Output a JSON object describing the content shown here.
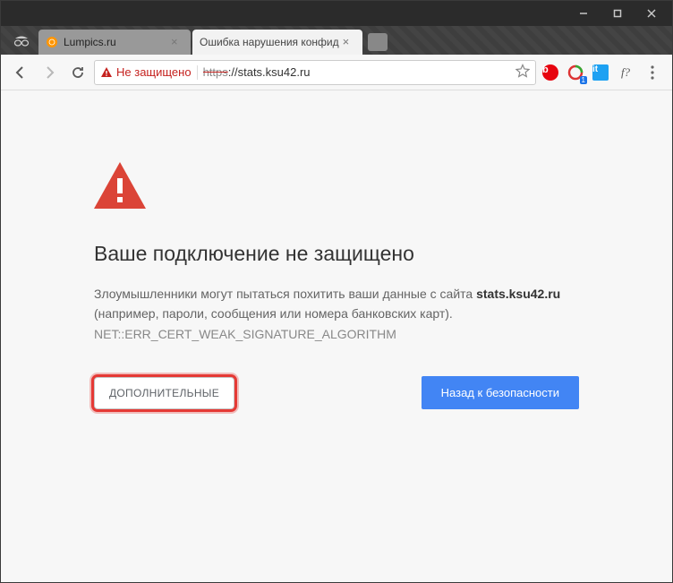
{
  "window": {
    "tabs": [
      {
        "title": "Lumpics.ru",
        "active": false
      },
      {
        "title": "Ошибка нарушения конфид",
        "active": true
      }
    ]
  },
  "toolbar": {
    "security_label": "Не защищено",
    "url_https": "https",
    "url_rest": "://stats.ksu42.ru",
    "ext_badge": "1",
    "ext_f": "f?"
  },
  "page": {
    "heading": "Ваше подключение не защищено",
    "body_before": "Злоумышленники могут пытаться похитить ваши данные с сайта ",
    "site": "stats.ksu42.ru",
    "body_after": " (например, пароли, сообщения или номера банковских карт). ",
    "error_code": "NET::ERR_CERT_WEAK_SIGNATURE_ALGORITHM",
    "advanced_label": "ДОПОЛНИТЕЛЬНЫЕ",
    "back_label": "Назад к безопасности"
  },
  "colors": {
    "danger": "#db4437",
    "primary": "#4285f4"
  }
}
